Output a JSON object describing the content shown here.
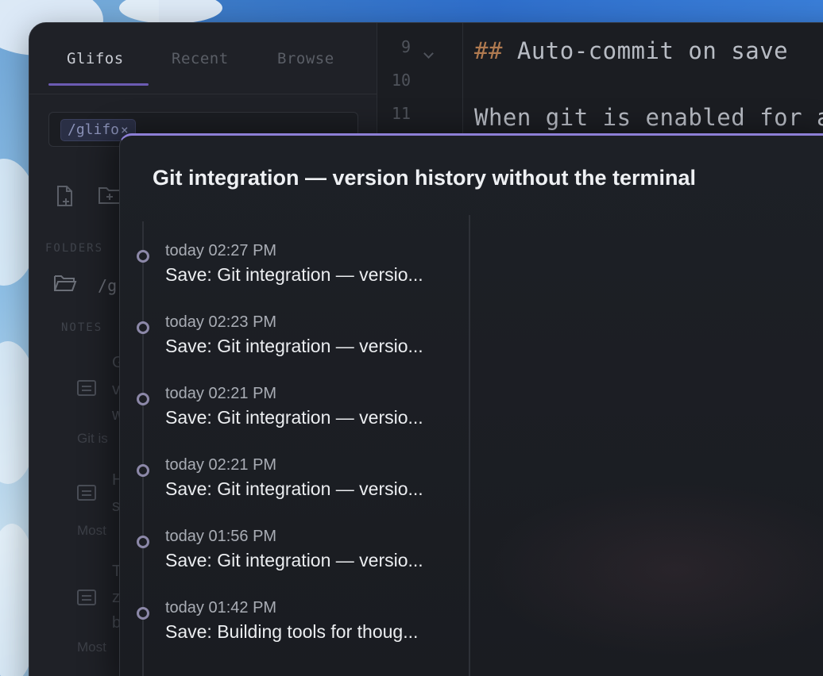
{
  "sidebar": {
    "tabs": [
      {
        "label": "Glifos",
        "active": true
      },
      {
        "label": "Recent",
        "active": false
      },
      {
        "label": "Browse",
        "active": false
      }
    ],
    "search_chip": "/glifo",
    "search_chip_close": "×",
    "folders_label": "FOLDERS",
    "folder_path": "/g",
    "notes_label": "NOTES",
    "notes": [
      {
        "lines": [
          "G",
          "v",
          "w"
        ],
        "preview": "Git is"
      },
      {
        "lines": [
          "H",
          "s"
        ],
        "preview": "Most"
      },
      {
        "lines": [
          "T",
          "z",
          "b"
        ],
        "preview": "Most"
      }
    ]
  },
  "editor": {
    "line_numbers": [
      "9",
      "10",
      "11"
    ],
    "lines": [
      {
        "prefix": "##",
        "text": " Auto-commit on save"
      },
      {
        "prefix": "",
        "text": ""
      },
      {
        "prefix": "",
        "text": "When git is enabled for a"
      }
    ]
  },
  "history_modal": {
    "title": "Git integration — version history without the terminal",
    "commits": [
      {
        "time": "today 02:27 PM",
        "message": "Save: Git integration — versio..."
      },
      {
        "time": "today 02:23 PM",
        "message": "Save: Git integration — versio..."
      },
      {
        "time": "today 02:21 PM",
        "message": "Save: Git integration — versio..."
      },
      {
        "time": "today 02:21 PM",
        "message": "Save: Git integration — versio..."
      },
      {
        "time": "today 01:56 PM",
        "message": "Save: Git integration — versio..."
      },
      {
        "time": "today 01:42 PM",
        "message": "Save: Building tools for thoug..."
      }
    ]
  },
  "colors": {
    "accent": "#8d7fd6",
    "window_bg": "#1b1d22",
    "markdown_heading": "#b07a50"
  }
}
